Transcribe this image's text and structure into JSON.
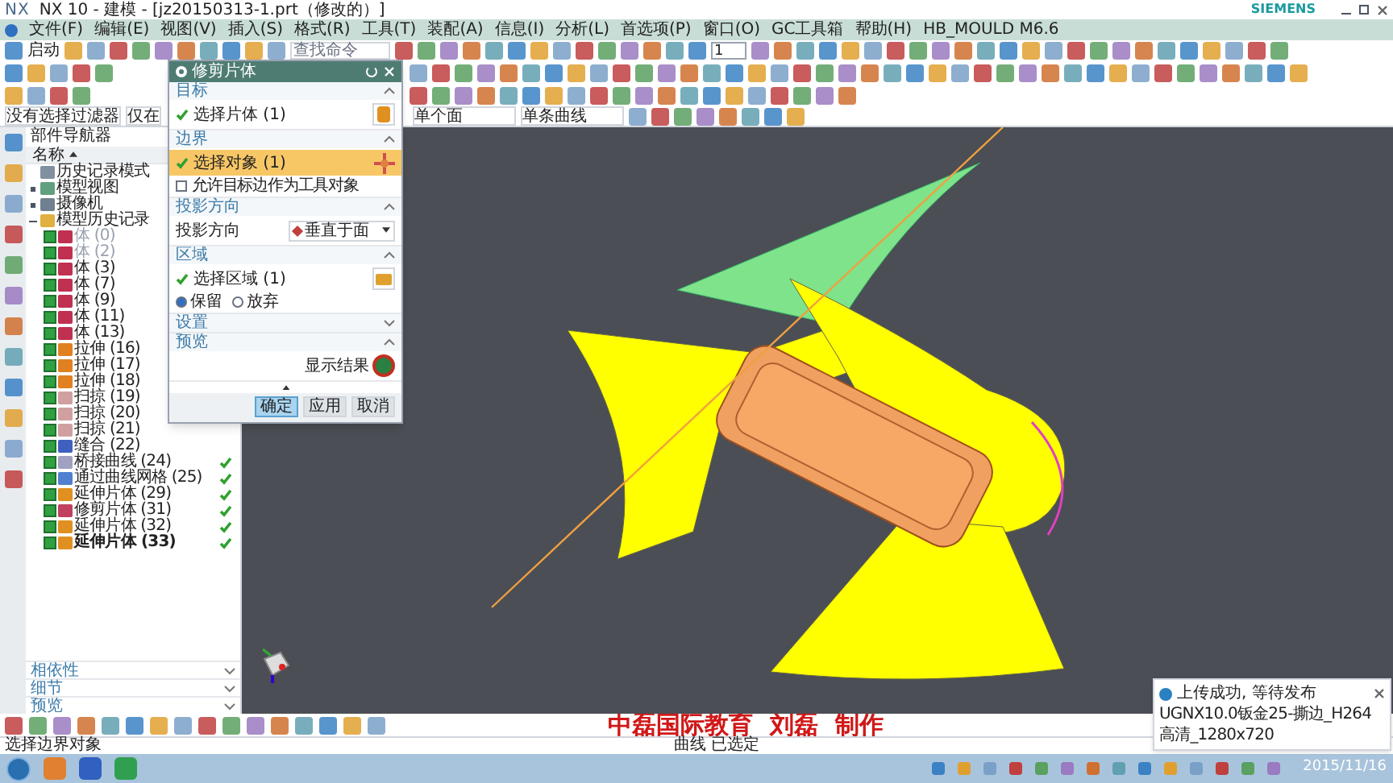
{
  "window": {
    "app_logo": "NX",
    "title": "NX 10 - 建模 - [jz20150313-1.prt（修改的）]",
    "brand": "SIEMENS"
  },
  "menu": [
    "文件(F)",
    "编辑(E)",
    "视图(V)",
    "插入(S)",
    "格式(R)",
    "工具(T)",
    "装配(A)",
    "信息(I)",
    "分析(L)",
    "首选项(P)",
    "窗口(O)",
    "GC工具箱",
    "帮助(H)",
    "HB_MOULD M6.6"
  ],
  "toolbar": {
    "start_label": "启动",
    "search": {
      "placeholder": "查找命令"
    },
    "layer_value": "1"
  },
  "selection_bar": {
    "filter": "没有选择过滤器",
    "scope": "仅在",
    "face_rule": "单个面",
    "curve_rule": "单条曲线"
  },
  "navigator": {
    "title": "部件导航器",
    "column": "名称",
    "items": [
      {
        "label": "历史记录模式",
        "kind": "mode"
      },
      {
        "label": "模型视图",
        "kind": "views",
        "expanded": false
      },
      {
        "label": "摄像机",
        "kind": "camera",
        "expanded": false
      },
      {
        "label": "模型历史记录",
        "kind": "history",
        "expanded": true,
        "children": [
          {
            "label": "体 (0)",
            "kind": "body",
            "checked": true,
            "dimmed": true,
            "done": false,
            "current": false
          },
          {
            "label": "体 (2)",
            "kind": "body",
            "checked": true,
            "dimmed": true,
            "done": false,
            "current": false
          },
          {
            "label": "体 (3)",
            "kind": "body",
            "checked": true,
            "dimmed": false,
            "done": false,
            "current": false
          },
          {
            "label": "体 (7)",
            "kind": "body",
            "checked": true,
            "dimmed": false,
            "done": false,
            "current": false
          },
          {
            "label": "体 (9)",
            "kind": "body",
            "checked": true,
            "dimmed": false,
            "done": false,
            "current": false
          },
          {
            "label": "体 (11)",
            "kind": "body",
            "checked": true,
            "dimmed": false,
            "done": false,
            "current": false
          },
          {
            "label": "体 (13)",
            "kind": "body",
            "checked": true,
            "dimmed": false,
            "done": false,
            "current": false
          },
          {
            "label": "拉伸 (16)",
            "kind": "extrude",
            "checked": true,
            "dimmed": false,
            "done": false,
            "current": false
          },
          {
            "label": "拉伸 (17)",
            "kind": "extrude",
            "checked": true,
            "dimmed": false,
            "done": false,
            "current": false
          },
          {
            "label": "拉伸 (18)",
            "kind": "extrude",
            "checked": true,
            "dimmed": false,
            "done": false,
            "current": false
          },
          {
            "label": "扫掠 (19)",
            "kind": "sweep",
            "checked": true,
            "dimmed": false,
            "done": false,
            "current": false
          },
          {
            "label": "扫掠 (20)",
            "kind": "sweep",
            "checked": true,
            "dimmed": false,
            "done": false,
            "current": false
          },
          {
            "label": "扫掠 (21)",
            "kind": "sweep",
            "checked": true,
            "dimmed": false,
            "done": false,
            "current": false
          },
          {
            "label": "缝合 (22)",
            "kind": "sew",
            "checked": true,
            "dimmed": false,
            "done": false,
            "current": false
          },
          {
            "label": "桥接曲线 (24)",
            "kind": "curve",
            "checked": true,
            "dimmed": false,
            "done": true,
            "current": false
          },
          {
            "label": "通过曲线网格 (25)",
            "kind": "mesh",
            "checked": true,
            "dimmed": false,
            "done": true,
            "current": false
          },
          {
            "label": "延伸片体 (29)",
            "kind": "extend",
            "checked": true,
            "dimmed": false,
            "done": true,
            "current": false
          },
          {
            "label": "修剪片体 (31)",
            "kind": "trim",
            "checked": true,
            "dimmed": false,
            "done": true,
            "current": false
          },
          {
            "label": "延伸片体 (32)",
            "kind": "extend",
            "checked": true,
            "dimmed": false,
            "done": true,
            "current": false
          },
          {
            "label": "延伸片体 (33)",
            "kind": "extend",
            "checked": true,
            "dimmed": false,
            "done": true,
            "current": true
          }
        ]
      }
    ],
    "panels": [
      "相依性",
      "细节",
      "预览"
    ]
  },
  "dialog": {
    "title": "修剪片体",
    "sections": [
      {
        "title": "目标",
        "expanded": true,
        "rows": [
          {
            "kind": "select",
            "label": "选择片体 (1)",
            "highlighted": false
          }
        ]
      },
      {
        "title": "边界",
        "expanded": true,
        "rows": [
          {
            "kind": "select",
            "label": "选择对象 (1)",
            "highlighted": true
          },
          {
            "kind": "checkbox",
            "label": "允许目标边作为工具对象",
            "checked": false
          }
        ]
      },
      {
        "title": "投影方向",
        "expanded": true,
        "rows": [
          {
            "kind": "dropdown",
            "label": "投影方向",
            "value": "垂直于面"
          }
        ]
      },
      {
        "title": "区域",
        "expanded": true,
        "rows": [
          {
            "kind": "select",
            "label": "选择区域 (1)",
            "highlighted": false
          },
          {
            "kind": "radios",
            "options": [
              {
                "label": "保留",
                "selected": true
              },
              {
                "label": "放弃",
                "selected": false
              }
            ]
          }
        ]
      },
      {
        "title": "设置",
        "expanded": false
      },
      {
        "title": "预览",
        "expanded": true,
        "rows": [
          {
            "kind": "preview",
            "label": "显示结果"
          }
        ]
      }
    ],
    "buttons": [
      {
        "label": "确定",
        "primary": true
      },
      {
        "label": "应用",
        "primary": false
      },
      {
        "label": "取消",
        "primary": false
      }
    ]
  },
  "caption": "中磊国际教育  刘磊  制作",
  "status_bar": {
    "prompt": "选择边界对象",
    "status": "曲线 已选定"
  },
  "notification": {
    "title": "上传成功, 等待发布",
    "lines": [
      "UGNX10.0钣金25-撕边_H264",
      "高清_1280x720"
    ]
  },
  "taskbar": {
    "date": "2015/11/16"
  }
}
